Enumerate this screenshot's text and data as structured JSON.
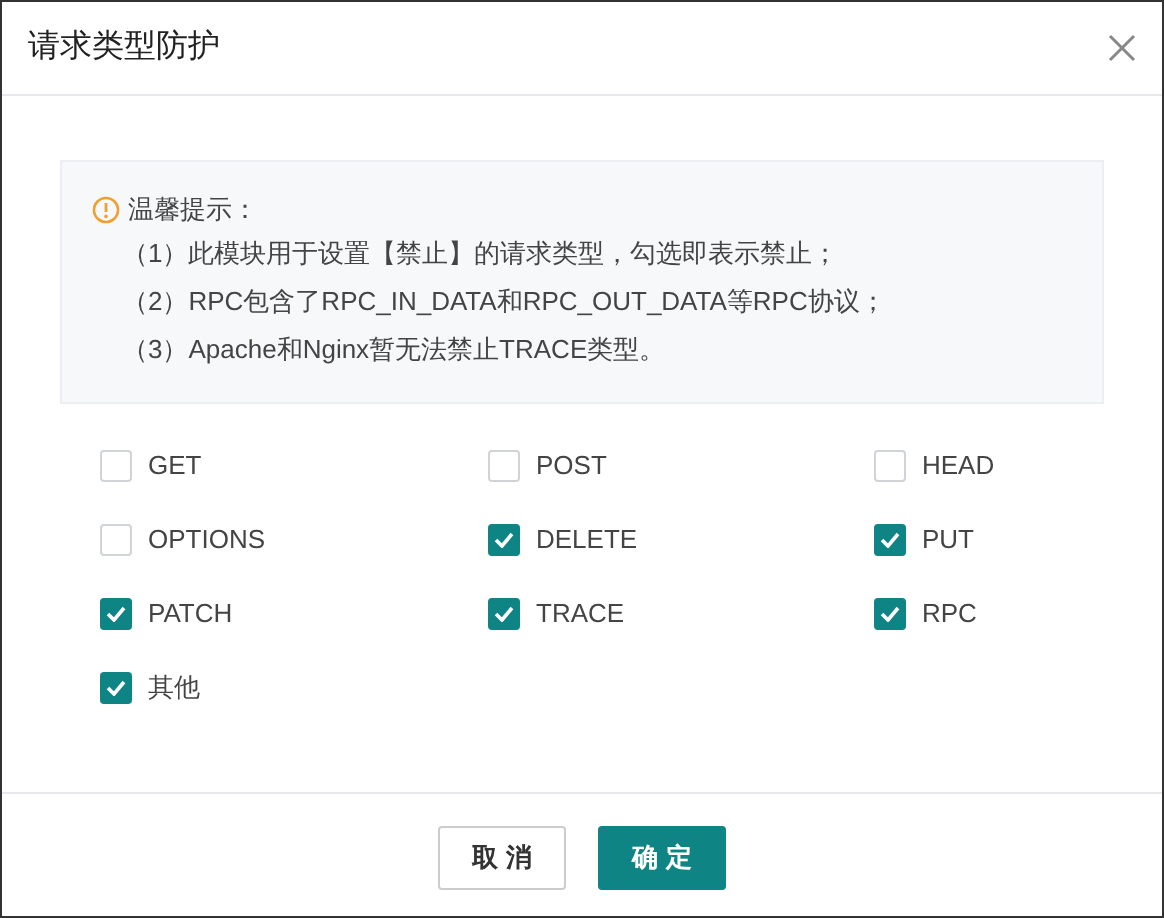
{
  "dialog": {
    "title": "请求类型防护"
  },
  "notice": {
    "heading": "温馨提示：",
    "lines": [
      "（1）此模块用于设置【禁止】的请求类型，勾选即表示禁止；",
      "（2）RPC包含了RPC_IN_DATA和RPC_OUT_DATA等RPC协议；",
      "（3）Apache和Nginx暂无法禁止TRACE类型。"
    ]
  },
  "options": [
    {
      "label": "GET",
      "checked": false
    },
    {
      "label": "POST",
      "checked": false
    },
    {
      "label": "HEAD",
      "checked": false
    },
    {
      "label": "OPTIONS",
      "checked": false
    },
    {
      "label": "DELETE",
      "checked": true
    },
    {
      "label": "PUT",
      "checked": true
    },
    {
      "label": "PATCH",
      "checked": true
    },
    {
      "label": "TRACE",
      "checked": true
    },
    {
      "label": "RPC",
      "checked": true
    },
    {
      "label": "其他",
      "checked": true
    }
  ],
  "buttons": [
    {
      "label": "取 消",
      "kind": "secondary"
    },
    {
      "label": "确 定",
      "kind": "primary"
    }
  ]
}
